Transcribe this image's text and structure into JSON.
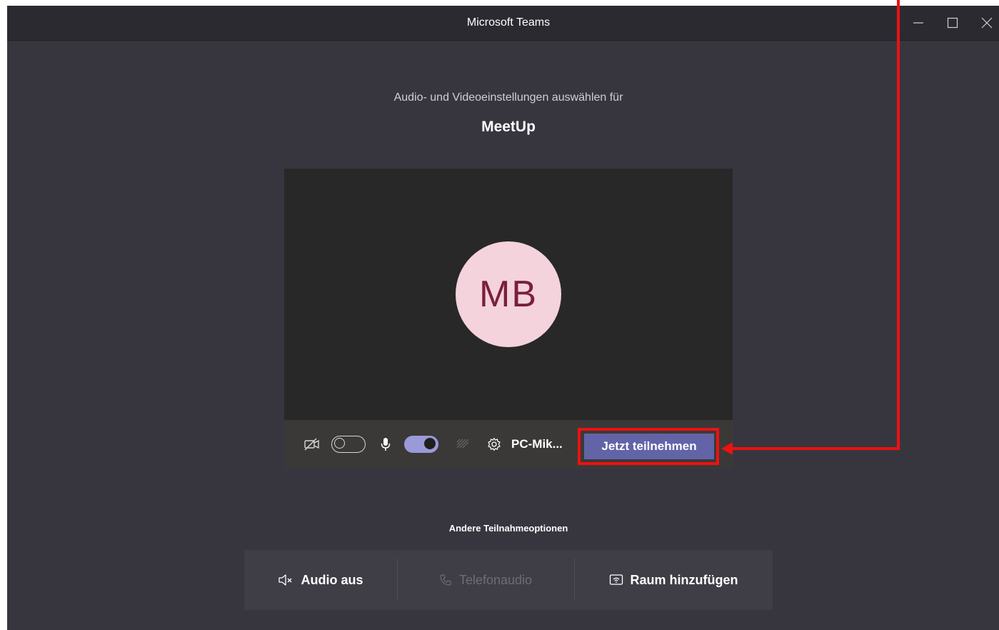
{
  "window": {
    "title": "Microsoft Teams",
    "controls": {
      "minimize_icon": "minimize-icon",
      "maximize_icon": "maximize-icon",
      "close_icon": "close-icon"
    }
  },
  "prejoin": {
    "subtitle": "Audio- und Videoeinstellungen auswählen für",
    "meeting_name": "MeetUp",
    "avatar_initials": "MB",
    "video_enabled": false,
    "mic_enabled": true,
    "device_label": "PC-Mik...",
    "join_label": "Jetzt teilnehmen"
  },
  "other_options": {
    "heading": "Andere Teilnahmeoptionen",
    "items": [
      {
        "label": "Audio aus",
        "icon": "speaker-muted-icon",
        "enabled": true
      },
      {
        "label": "Telefonaudio",
        "icon": "phone-icon",
        "enabled": false
      },
      {
        "label": "Raum hinzufügen",
        "icon": "room-cast-icon",
        "enabled": true
      }
    ]
  },
  "colors": {
    "window_bg": "#37363f",
    "titlebar_bg": "#2b2a30",
    "accent": "#6264a7",
    "toggle_on": "#9a9ad9",
    "avatar_bg": "#f4d3dc",
    "avatar_text": "#7a1f3d",
    "annotation": "#ee1111"
  }
}
